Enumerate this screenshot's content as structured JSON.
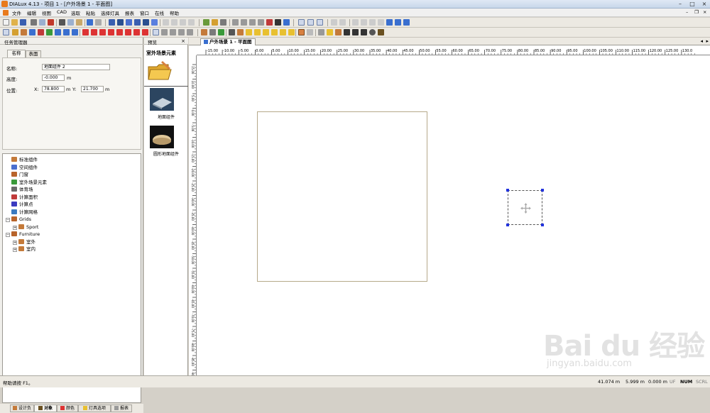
{
  "window": {
    "title": "DIALux 4.13 - 项目 1 - [户外场景 1 - 平面图]"
  },
  "menu": [
    "文件",
    "编辑",
    "视图",
    "CAD",
    "选取",
    "粘贴",
    "选择灯具",
    "报表",
    "窗口",
    "在线",
    "帮助"
  ],
  "task_manager": {
    "title": "任务管理器",
    "tabs": [
      "名称",
      "表面"
    ],
    "active_tab": 0,
    "fields": {
      "name_label": "名称:",
      "name_value": "地面组件 2",
      "height_label": "高度:",
      "height_value": "-0.000",
      "height_unit": "m",
      "position_label": "位置:",
      "x_label": "X:",
      "x_value": "78.800",
      "x_unit": "m",
      "y_label": "Y:",
      "y_value": "21.700",
      "y_unit": "m"
    },
    "tree": [
      {
        "label": "标准组件",
        "indent": 0,
        "expander": "",
        "icon_color": "#c47a3a"
      },
      {
        "label": "空间组件",
        "indent": 0,
        "expander": "",
        "icon_color": "#4a6fcf"
      },
      {
        "label": "门窗",
        "indent": 0,
        "expander": "",
        "icon_color": "#b8642b"
      },
      {
        "label": "室外场景元素",
        "indent": 0,
        "expander": "",
        "icon_color": "#3a9a3a"
      },
      {
        "label": "体育场",
        "indent": 0,
        "expander": "",
        "icon_color": "#6a6a6a"
      },
      {
        "label": "计算面积",
        "indent": 0,
        "expander": "",
        "icon_color": "#c03a3a"
      },
      {
        "label": "计算点",
        "indent": 0,
        "expander": "",
        "icon_color": "#3a3ac0"
      },
      {
        "label": "计算网格",
        "indent": 0,
        "expander": "",
        "icon_color": "#3a7ac0"
      },
      {
        "label": "Grids",
        "indent": 0,
        "expander": "−",
        "icon_color": "#b8642b"
      },
      {
        "label": "Sport",
        "indent": 1,
        "expander": "+",
        "icon_color": "#c47a3a"
      },
      {
        "label": "Furniture",
        "indent": 0,
        "expander": "−",
        "icon_color": "#b8642b"
      },
      {
        "label": "室外",
        "indent": 1,
        "expander": "+",
        "icon_color": "#c47a3a"
      },
      {
        "label": "室内",
        "indent": 1,
        "expander": "+",
        "icon_color": "#c47a3a"
      }
    ],
    "bottom_tabs": [
      "设计负",
      "对象",
      "颜色",
      "灯具选项",
      "报表"
    ],
    "bottom_active": 1
  },
  "preview": {
    "title": "预览",
    "close": "×",
    "heading": "室外场景元素",
    "items": [
      {
        "label": "地面组件"
      },
      {
        "label": "圆形地面组件"
      }
    ]
  },
  "document": {
    "tab_label": "户外场景 1 - 平面图",
    "hruler_ticks": [
      "-15.00",
      "-10.00",
      "-5.00",
      "0.00",
      "5.00",
      "10.00",
      "15.00",
      "20.00",
      "25.00",
      "30.00",
      "35.00",
      "40.00",
      "45.00",
      "50.00",
      "55.00",
      "60.00",
      "65.00",
      "70.00",
      "75.00",
      "80.00",
      "85.00",
      "90.00",
      "95.00",
      "100.00",
      "105.00",
      "110.00",
      "115.00",
      "120.00",
      "125.00",
      "130.0"
    ],
    "vruler_ticks": [
      "15.00",
      "10.00",
      "5.00",
      "0.00",
      "-5.00",
      "-10.00",
      "-15.00",
      "-20.00",
      "-25.00",
      "-30.00",
      "-35.00",
      "-40.00",
      "-45.00",
      "-50.00",
      "-55.00",
      "-60.00",
      "-65.00",
      "-70.00",
      "-75.00",
      "-80.00",
      "-85.00",
      "-90.00",
      "-95.00"
    ]
  },
  "status": {
    "help": "帮助请按 F1。",
    "x": "41.074 m",
    "y": "5.999 m",
    "z": "0.000 m",
    "flags": [
      "UF",
      "NUM",
      "SCRL"
    ]
  },
  "watermark": {
    "text": "Bai du 经验",
    "sub": "jingyan.baidu.com"
  },
  "colors": {
    "selection_handle": "#2233dd",
    "element_outline": "#b6a98a"
  }
}
